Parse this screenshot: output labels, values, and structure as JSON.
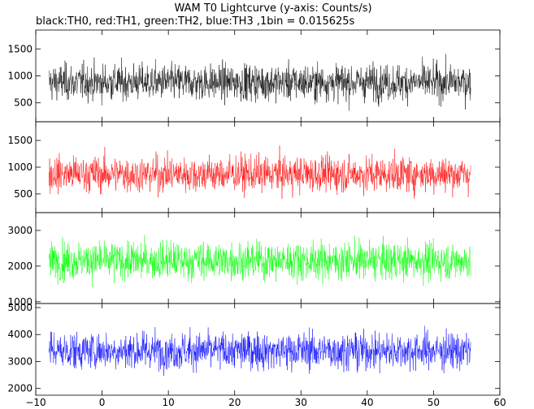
{
  "chart_data": {
    "type": "line",
    "title": "WAM T0 Lightcurve (y-axis: Counts/s)",
    "subtitle": "black:TH0, red:TH1, green:TH2, blue:TH3 ,1bin = 0.015625s",
    "xlim": [
      -10,
      60
    ],
    "x_ticks": [
      "−10",
      "0",
      "10",
      "20",
      "30",
      "40",
      "50",
      "60"
    ],
    "x_data_range": [
      -8,
      55.6
    ],
    "bin_s": 0.015625,
    "grid": false,
    "legend": "none",
    "panels": [
      {
        "series": "TH0",
        "color": "#000000",
        "ylim": [
          150,
          1850
        ],
        "y_ticks": [
          500,
          1000,
          1500
        ],
        "y_tick_labels": [
          "500",
          "1000",
          "1500"
        ],
        "mean": 880,
        "spread": 560
      },
      {
        "series": "TH1",
        "color": "#ff0000",
        "ylim": [
          150,
          1850
        ],
        "y_ticks": [
          500,
          1000,
          1500
        ],
        "y_tick_labels": [
          "500",
          "1000",
          "1500"
        ],
        "mean": 870,
        "spread": 560
      },
      {
        "series": "TH2",
        "color": "#00ff00",
        "ylim": [
          950,
          3500
        ],
        "y_ticks": [
          1000,
          2000,
          3000
        ],
        "y_tick_labels": [
          "1000",
          "2000",
          "3000"
        ],
        "mean": 2150,
        "spread": 880
      },
      {
        "series": "TH3",
        "color": "#0000ff",
        "ylim": [
          1750,
          5150
        ],
        "y_ticks": [
          2000,
          3000,
          4000,
          5000
        ],
        "y_tick_labels": [
          "2000",
          "3000",
          "4000",
          "5000"
        ],
        "mean": 3400,
        "spread": 1150
      }
    ]
  }
}
